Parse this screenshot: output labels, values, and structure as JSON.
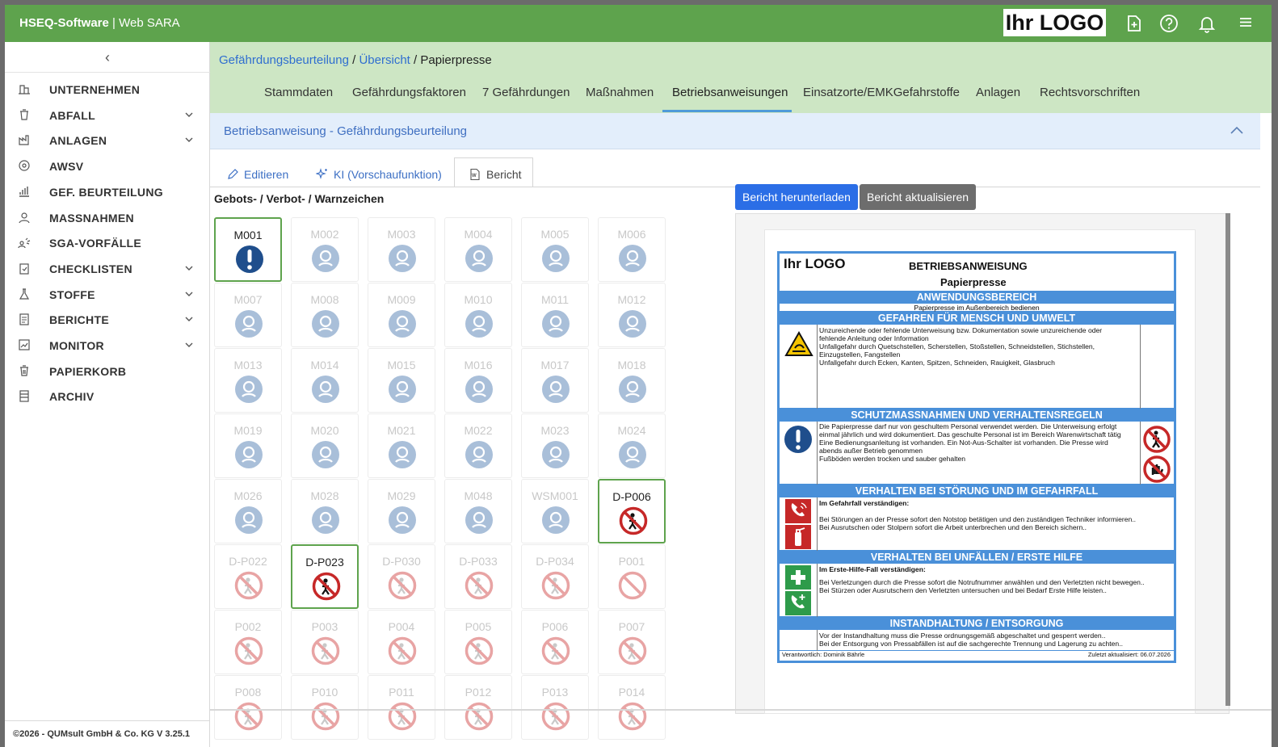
{
  "topbar": {
    "brand_bold": "HSEQ-Software",
    "brand_sep": " | ",
    "brand_rest": "Web SARA",
    "logo": "Ihr LOGO",
    "icons": [
      "new-document-icon",
      "help-icon",
      "bell-icon",
      "hamburger-menu-icon"
    ]
  },
  "sidebar": {
    "collapse": "‹",
    "items": [
      {
        "label": "UNTERNEHMEN",
        "expandable": false
      },
      {
        "label": "ABFALL",
        "expandable": true
      },
      {
        "label": "ANLAGEN",
        "expandable": true
      },
      {
        "label": "AWSV",
        "expandable": false
      },
      {
        "label": "GEF. BEURTEILUNG",
        "expandable": false
      },
      {
        "label": "MASSNAHMEN",
        "expandable": false
      },
      {
        "label": "SGA-VORFÄLLE",
        "expandable": false
      },
      {
        "label": "CHECKLISTEN",
        "expandable": true
      },
      {
        "label": "STOFFE",
        "expandable": true
      },
      {
        "label": "BERICHTE",
        "expandable": true
      },
      {
        "label": "MONITOR",
        "expandable": true
      },
      {
        "label": "PAPIERKORB",
        "expandable": false
      },
      {
        "label": "ARCHIV",
        "expandable": false
      }
    ],
    "footer": "©2026 - QUMsult GmbH & Co. KG    V 3.25.1"
  },
  "breadcrumb": {
    "link1": "Gefährdungsbeurteilung",
    "sep": " / ",
    "link2": "Übersicht",
    "current": "Papierpresse"
  },
  "tabs": [
    {
      "label": "Stammdaten"
    },
    {
      "label": "Gefährdungsfaktoren"
    },
    {
      "label": "7 Gefährdungen"
    },
    {
      "label": "Maßnahmen"
    },
    {
      "label": "Betriebsanweisungen",
      "active": true
    },
    {
      "label": "Einsatzorte/EMKGefahrstoffe"
    },
    {
      "label": "Anlagen"
    },
    {
      "label": "Rechtsvorschriften"
    }
  ],
  "section": {
    "title": "Betriebsanweisung - Gefährdungsbeurteilung"
  },
  "subtabs": [
    {
      "label": "Editieren"
    },
    {
      "label": "KI (Vorschaufunktion)"
    },
    {
      "label": "Bericht",
      "active": true
    }
  ],
  "signs": {
    "title": "Gebots- / Verbot- / Warnzeichen",
    "items": [
      {
        "code": "M001",
        "selected": true,
        "type": "mandatory"
      },
      {
        "code": "M002",
        "selected": false,
        "type": "mandatory"
      },
      {
        "code": "M003",
        "selected": false,
        "type": "mandatory"
      },
      {
        "code": "M004",
        "selected": false,
        "type": "mandatory"
      },
      {
        "code": "M005",
        "selected": false,
        "type": "mandatory"
      },
      {
        "code": "M006",
        "selected": false,
        "type": "mandatory"
      },
      {
        "code": "M007",
        "selected": false,
        "type": "mandatory"
      },
      {
        "code": "M008",
        "selected": false,
        "type": "mandatory"
      },
      {
        "code": "M009",
        "selected": false,
        "type": "mandatory"
      },
      {
        "code": "M010",
        "selected": false,
        "type": "mandatory"
      },
      {
        "code": "M011",
        "selected": false,
        "type": "mandatory"
      },
      {
        "code": "M012",
        "selected": false,
        "type": "mandatory"
      },
      {
        "code": "M013",
        "selected": false,
        "type": "mandatory"
      },
      {
        "code": "M014",
        "selected": false,
        "type": "mandatory"
      },
      {
        "code": "M015",
        "selected": false,
        "type": "mandatory"
      },
      {
        "code": "M016",
        "selected": false,
        "type": "mandatory"
      },
      {
        "code": "M017",
        "selected": false,
        "type": "mandatory"
      },
      {
        "code": "M018",
        "selected": false,
        "type": "mandatory"
      },
      {
        "code": "M019",
        "selected": false,
        "type": "mandatory"
      },
      {
        "code": "M020",
        "selected": false,
        "type": "mandatory"
      },
      {
        "code": "M021",
        "selected": false,
        "type": "mandatory"
      },
      {
        "code": "M022",
        "selected": false,
        "type": "mandatory"
      },
      {
        "code": "M023",
        "selected": false,
        "type": "mandatory"
      },
      {
        "code": "M024",
        "selected": false,
        "type": "mandatory"
      },
      {
        "code": "M026",
        "selected": false,
        "type": "mandatory"
      },
      {
        "code": "M028",
        "selected": false,
        "type": "mandatory"
      },
      {
        "code": "M029",
        "selected": false,
        "type": "mandatory"
      },
      {
        "code": "M048",
        "selected": false,
        "type": "mandatory"
      },
      {
        "code": "WSM001",
        "selected": false,
        "type": "mandatory"
      },
      {
        "code": "D-P006",
        "selected": true,
        "type": "prohibition"
      },
      {
        "code": "D-P022",
        "selected": false,
        "type": "prohibition"
      },
      {
        "code": "D-P023",
        "selected": true,
        "type": "prohibition"
      },
      {
        "code": "D-P030",
        "selected": false,
        "type": "prohibition"
      },
      {
        "code": "D-P033",
        "selected": false,
        "type": "prohibition"
      },
      {
        "code": "D-P034",
        "selected": false,
        "type": "prohibition"
      },
      {
        "code": "P001",
        "selected": false,
        "type": "prohibition"
      },
      {
        "code": "P002",
        "selected": false,
        "type": "prohibition"
      },
      {
        "code": "P003",
        "selected": false,
        "type": "prohibition"
      },
      {
        "code": "P004",
        "selected": false,
        "type": "prohibition"
      },
      {
        "code": "P005",
        "selected": false,
        "type": "prohibition"
      },
      {
        "code": "P006",
        "selected": false,
        "type": "prohibition"
      },
      {
        "code": "P007",
        "selected": false,
        "type": "prohibition"
      },
      {
        "code": "P008",
        "selected": false,
        "type": "prohibition"
      },
      {
        "code": "P010",
        "selected": false,
        "type": "prohibition"
      },
      {
        "code": "P011",
        "selected": false,
        "type": "prohibition"
      },
      {
        "code": "P012",
        "selected": false,
        "type": "prohibition"
      },
      {
        "code": "P013",
        "selected": false,
        "type": "prohibition"
      },
      {
        "code": "P014",
        "selected": false,
        "type": "prohibition"
      }
    ]
  },
  "buttons": {
    "download": "Bericht herunterladen",
    "refresh": "Bericht aktualisieren"
  },
  "report": {
    "logo": "Ihr LOGO",
    "title": "BETRIEBSANWEISUNG",
    "subtitle": "Papierpresse",
    "s1_head": "ANWENDUNGSBEREICH",
    "s1_text": "Papierpresse im Außenbereich bedienen",
    "s2_head": "GEFAHREN FÜR MENSCH UND UMWELT",
    "s2_lines": [
      "Unzureichende oder fehlende Unterweisung bzw. Dokumentation sowie unzureichende oder",
      "fehlende Anleitung oder Information",
      "Unfallgefahr durch Quetschstellen, Scherstellen, Stoßstellen, Schneidstellen, Stichstellen,",
      "Einzugstellen, Fangstellen",
      "Unfallgefahr durch Ecken, Kanten, Spitzen, Schneiden, Rauigkeit, Glasbruch"
    ],
    "s3_head": "SCHUTZMASSNAHMEN UND VERHALTENSREGELN",
    "s3_lines": [
      "Die Papierpresse darf nur von geschultem Personal verwendet werden. Die Unterweisung erfolgt",
      "einmal jährlich und wird dokumentiert. Das geschulte Personal ist im Bereich Warenwirtschaft tätig",
      "Eine Bedienungsanleitung ist vorhanden. Ein Not-Aus-Schalter ist vorhanden. Die Presse wird",
      "abends außer Betrieb genommen",
      "Fußböden werden trocken und sauber gehalten"
    ],
    "s4_head": "VERHALTEN BEI STÖRUNG UND IM GEFAHRFALL",
    "s4_bold": "Im Gefahrfall verständigen:",
    "s4_lines": [
      "Bei Störungen an der Presse sofort den Notstop betätigen und den zuständigen Techniker informieren..",
      "Bei Ausrutschen oder Stolpern sofort die Arbeit unterbrechen und den Bereich sichern.."
    ],
    "s5_head": "VERHALTEN BEI UNFÄLLEN / ERSTE HILFE",
    "s5_bold": "Im Erste-Hilfe-Fall verständigen:",
    "s5_lines": [
      "Bei Verletzungen durch die Presse sofort die Notrufnummer anwählen und den Verletzten nicht bewegen..",
      "Bei Stürzen oder Ausrutschern den Verletzten untersuchen und bei Bedarf Erste Hilfe leisten.."
    ],
    "s6_head": "INSTANDHALTUNG / ENTSORGUNG",
    "s6_lines": [
      "Vor der Instandhaltung muss die Presse ordnungsgemäß abgeschaltet und gesperrt werden..",
      "Bei der Entsorgung von Pressabfällen ist auf die sachgerechte Trennung und Lagerung zu achten.."
    ],
    "footer_left": "Verantwortlich: Dominik Bährle",
    "footer_right": "Zuletzt aktualisiert: 06.07.2026"
  },
  "colors": {
    "topbar": "#5ea34d",
    "header_green": "#cde6c4",
    "mandatory_blue": "#1f4e8c",
    "prohibition_red": "#c62828",
    "report_blue": "#4a90d9",
    "primary_button": "#2b6ee6"
  }
}
